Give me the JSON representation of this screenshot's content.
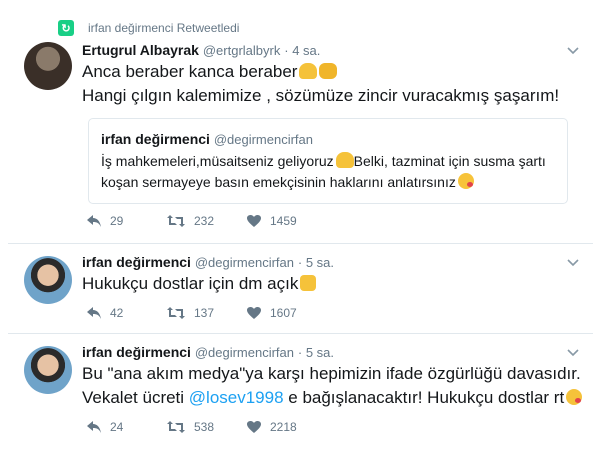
{
  "tweets": [
    {
      "retweet_context": "irfan değirmenci Retweetledi",
      "name": "Ertugrul Albayrak",
      "handle": "@ertgrlalbyrk",
      "time": "· 4 sa.",
      "text_lines": [
        "Anca beraber kanca beraber",
        "Hangi çılgın kalemimize , sözümüze zincir vuracakmış şaşarım!"
      ],
      "quote": {
        "name": "irfan değirmenci",
        "handle": "@degirmencirfan",
        "text_lines": [
          "İş mahkemeleri,müsaitseniz geliyoruz",
          "Belki, tazminat için susma şartı",
          "koşan sermayeye basın emekçisinin haklarını anlatırsınız"
        ]
      },
      "replies": "29",
      "retweets": "232",
      "likes": "1459"
    },
    {
      "name": "irfan değirmenci",
      "handle": "@degirmencirfan",
      "time": "· 5 sa.",
      "text_lines": [
        "Hukukçu dostlar için dm açık"
      ],
      "replies": "42",
      "retweets": "137",
      "likes": "1607"
    },
    {
      "name": "irfan değirmenci",
      "handle": "@degirmencirfan",
      "time": "· 5 sa.",
      "text_lines": [
        "Bu \"ana akım medya\"ya karşı hepimizin ifade özgürlüğü davasıdır.",
        "Vekalet ücreti ",
        "@losev1998",
        " e bağışlanacaktır! Hukukçu dostlar rt"
      ],
      "replies": "24",
      "retweets": "538",
      "likes": "2218"
    }
  ],
  "colors": {
    "accent": "#1da1f2",
    "retweet": "#19cf86",
    "muted": "#657786",
    "border": "#e1e8ed"
  },
  "icons": [
    "retweet-context-icon",
    "chevron-down-icon",
    "reply-icon",
    "retweet-icon",
    "like-icon"
  ]
}
